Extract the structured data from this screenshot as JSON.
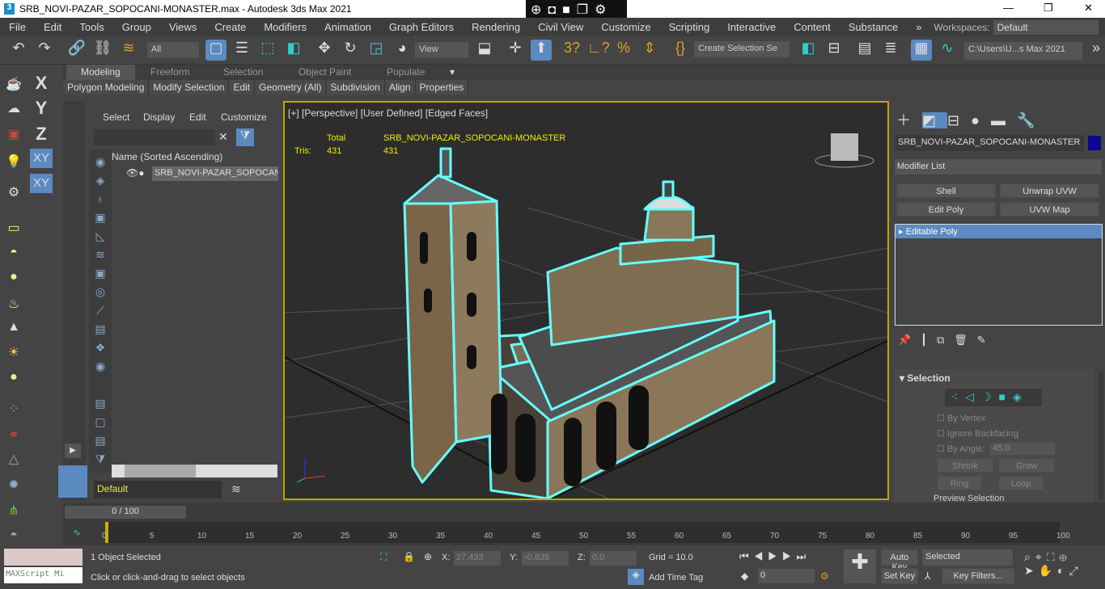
{
  "title": "SRB_NOVI-PAZAR_SOPOCANI-MONASTER.max - Autodesk 3ds Max 2021",
  "menu": [
    "File",
    "Edit",
    "Tools",
    "Group",
    "Views",
    "Create",
    "Modifiers",
    "Animation",
    "Graph Editors",
    "Rendering",
    "Civil View",
    "Customize",
    "Scripting",
    "Interactive",
    "Content",
    "Substance"
  ],
  "workspaces_label": "Workspaces:",
  "workspace": "Default",
  "toolbar": {
    "filter": "All",
    "ref_coord": "View",
    "selection_set": "Create Selection Se",
    "project_path": "C:\\Users\\U...s Max 2021"
  },
  "ribbon_tabs": [
    "Modeling",
    "Freeform",
    "Selection",
    "Object Paint",
    "Populate"
  ],
  "ribbon_panels": [
    "Polygon Modeling",
    "Modify Selection",
    "Edit",
    "Geometry (All)",
    "Subdivision",
    "Align",
    "Properties"
  ],
  "left_axes": [
    "X",
    "Y",
    "Z",
    "XY",
    "XY"
  ],
  "scene": {
    "menu": [
      "Select",
      "Display",
      "Edit",
      "Customize"
    ],
    "column": "Name (Sorted Ascending)",
    "item": "SRB_NOVI-PAZAR_SOPOCANI-MONASTER",
    "layer": "Default"
  },
  "viewport": {
    "label": "[+] [Perspective] [User Defined] [Edged Faces]",
    "stats_total": "Total",
    "stats_object": "SRB_NOVI-PAZAR_SOPOCANI-MONASTER",
    "tris_label": "Tris:",
    "tris_total": "431",
    "tris_object": "431"
  },
  "cmd": {
    "object_name": "SRB_NOVI-PAZAR_SOPOCANI-MONASTER",
    "object_color": "#0a0a8c",
    "modifier_list": "Modifier List",
    "mod_buttons": [
      "Shell",
      "Unwrap UVW",
      "Edit Poly",
      "UVW Map"
    ],
    "stack_item": "Editable Poly",
    "rollout": "Selection",
    "by_vertex": "By Vertex",
    "ignore_backfacing": "Ignore Backfacing",
    "by_angle": "By Angle:",
    "angle": "45.0",
    "shrink": "Shrink",
    "grow": "Grow",
    "ring": "Ring",
    "loop": "Loop",
    "preview": "Preview Selection"
  },
  "timeline": {
    "frame": "0 / 100",
    "ticks": [
      "0",
      "5",
      "10",
      "15",
      "20",
      "25",
      "30",
      "35",
      "40",
      "45",
      "50",
      "55",
      "60",
      "65",
      "70",
      "75",
      "80",
      "85",
      "90",
      "95",
      "100"
    ]
  },
  "status": {
    "selected": "1 Object Selected",
    "prompt": "Click or click-and-drag to select objects",
    "maxscript": "MAXScript Mi",
    "x_label": "X:",
    "x": "27.433",
    "y_label": "Y:",
    "y": "-0.839",
    "z_label": "Z:",
    "z": "0.0",
    "grid": "Grid = 10.0",
    "add_time_tag": "Add Time Tag",
    "auto_key": "Auto Key",
    "set_key": "Set Key",
    "key_mode": "Selected",
    "frame": "0",
    "key_filters": "Key Filters..."
  }
}
